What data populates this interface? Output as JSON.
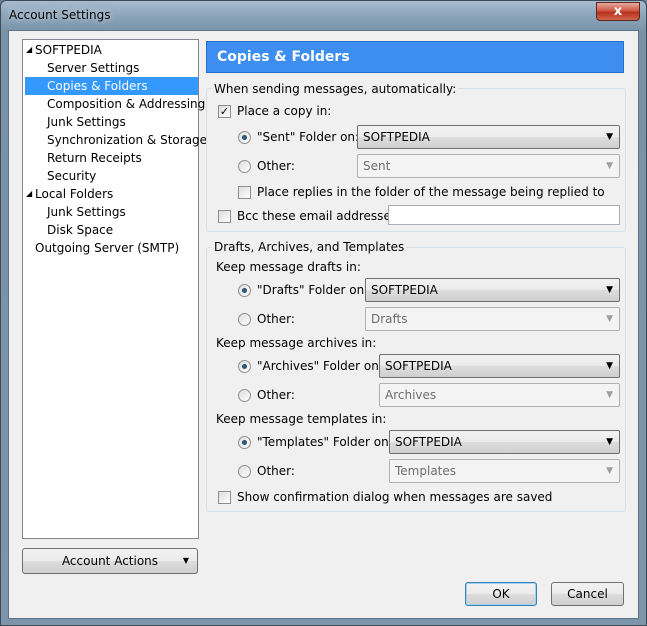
{
  "window": {
    "title": "Account Settings",
    "close_glyph": "x"
  },
  "tree": {
    "items": [
      {
        "label": "SOFTPEDIA",
        "level": 0,
        "expanded": true
      },
      {
        "label": "Server Settings",
        "level": 1
      },
      {
        "label": "Copies & Folders",
        "level": 1,
        "selected": true
      },
      {
        "label": "Composition & Addressing",
        "level": 1
      },
      {
        "label": "Junk Settings",
        "level": 1
      },
      {
        "label": "Synchronization & Storage",
        "level": 1
      },
      {
        "label": "Return Receipts",
        "level": 1
      },
      {
        "label": "Security",
        "level": 1
      },
      {
        "label": "Local Folders",
        "level": 0,
        "expanded": true
      },
      {
        "label": "Junk Settings",
        "level": 1
      },
      {
        "label": "Disk Space",
        "level": 1
      },
      {
        "label": "Outgoing Server (SMTP)",
        "level": 0
      }
    ],
    "expanded_glyph": "◢"
  },
  "account_actions": {
    "label": "Account Actions",
    "arrow": "▼"
  },
  "header": {
    "title": "Copies & Folders"
  },
  "sending": {
    "group_title": "When sending messages, automatically:",
    "place_copy": {
      "label": "Place a copy in:",
      "checked": true,
      "check_glyph": "✓"
    },
    "sent_folder": {
      "label": "\"Sent\" Folder on:",
      "value": "SOFTPEDIA"
    },
    "other": {
      "label": "Other:",
      "value": "Sent"
    },
    "place_replies": {
      "label": "Place replies in the folder of the message being replied to",
      "checked": false
    },
    "bcc": {
      "label": "Bcc these email addresses:",
      "checked": false,
      "value": ""
    }
  },
  "drafts_group": {
    "group_title": "Drafts, Archives, and Templates",
    "drafts_heading": "Keep message drafts in:",
    "drafts_folder": {
      "label": "\"Drafts\" Folder on:",
      "value": "SOFTPEDIA"
    },
    "drafts_other": {
      "label": "Other:",
      "value": "Drafts"
    },
    "archives_heading": "Keep message archives in:",
    "archives_folder": {
      "label": "\"Archives\" Folder on:",
      "value": "SOFTPEDIA"
    },
    "archives_other": {
      "label": "Other:",
      "value": "Archives"
    },
    "templates_heading": "Keep message templates in:",
    "templates_folder": {
      "label": "\"Templates\" Folder on:",
      "value": "SOFTPEDIA"
    },
    "templates_other": {
      "label": "Other:",
      "value": "Templates"
    },
    "show_confirmation": {
      "label": "Show confirmation dialog when messages are saved",
      "checked": false
    }
  },
  "buttons": {
    "ok": "OK",
    "cancel": "Cancel"
  },
  "dropdown_arrow": "▼"
}
